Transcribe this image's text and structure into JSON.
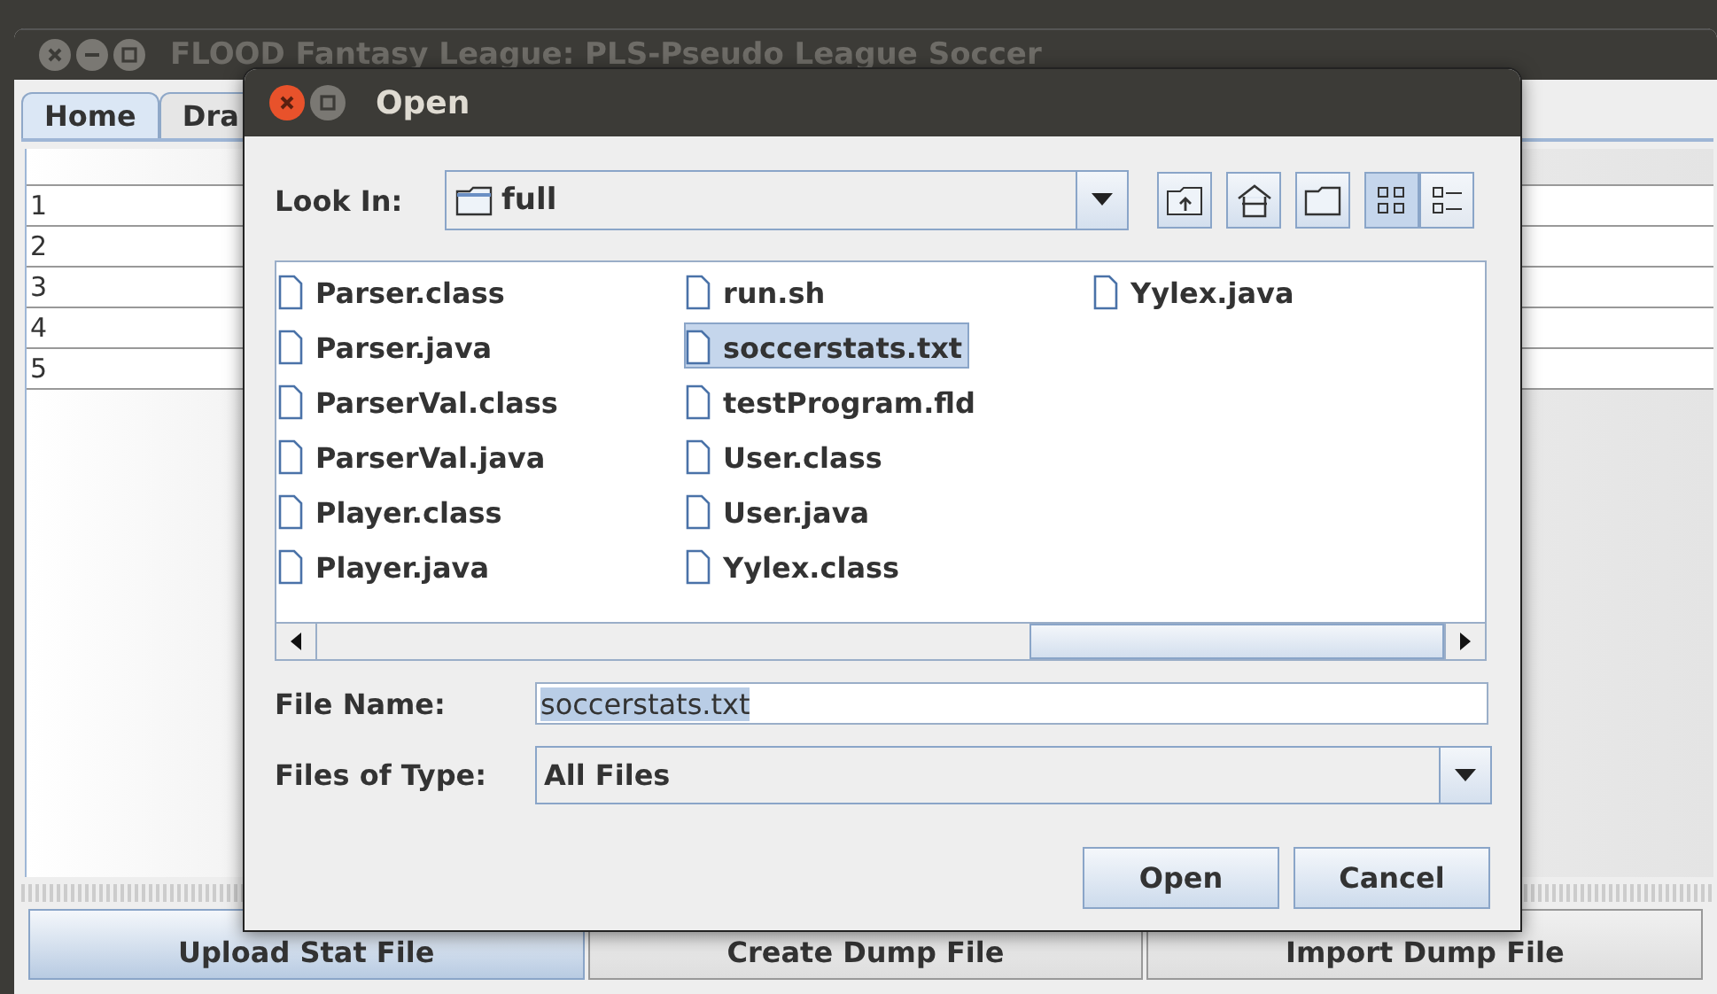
{
  "window": {
    "title": "FLOOD Fantasy League: PLS-Pseudo League Soccer"
  },
  "tabs": [
    {
      "label": "Home",
      "selected": true
    },
    {
      "label": "Dra",
      "selected": false
    }
  ],
  "table": {
    "rows": [
      "1",
      "2",
      "3",
      "4",
      "5"
    ]
  },
  "buttons": [
    {
      "label": "Upload Stat File",
      "focused": true
    },
    {
      "label": "Create Dump File",
      "focused": false
    },
    {
      "label": "Import Dump File",
      "focused": false
    }
  ],
  "dialog": {
    "title": "Open",
    "look_in": {
      "label": "Look In:",
      "value": "full"
    },
    "views": [
      {
        "kind": "list",
        "selected": true
      },
      {
        "kind": "details",
        "selected": false
      }
    ],
    "files": [
      {
        "name": "Parser.class",
        "selected": false
      },
      {
        "name": "Parser.java",
        "selected": false
      },
      {
        "name": "ParserVal.class",
        "selected": false
      },
      {
        "name": "ParserVal.java",
        "selected": false
      },
      {
        "name": "Player.class",
        "selected": false
      },
      {
        "name": "Player.java",
        "selected": false
      },
      {
        "name": "run.sh",
        "selected": false
      },
      {
        "name": "soccerstats.txt",
        "selected": true
      },
      {
        "name": "testProgram.fld",
        "selected": false
      },
      {
        "name": "User.class",
        "selected": false
      },
      {
        "name": "User.java",
        "selected": false
      },
      {
        "name": "Yylex.class",
        "selected": false
      },
      {
        "name": "Yylex.java",
        "selected": false
      }
    ],
    "file_name": {
      "label": "File Name:",
      "value": "soccerstats.txt"
    },
    "file_type": {
      "label": "Files of Type:",
      "value": "All Files"
    },
    "buttons": [
      "Open",
      "Cancel"
    ]
  }
}
